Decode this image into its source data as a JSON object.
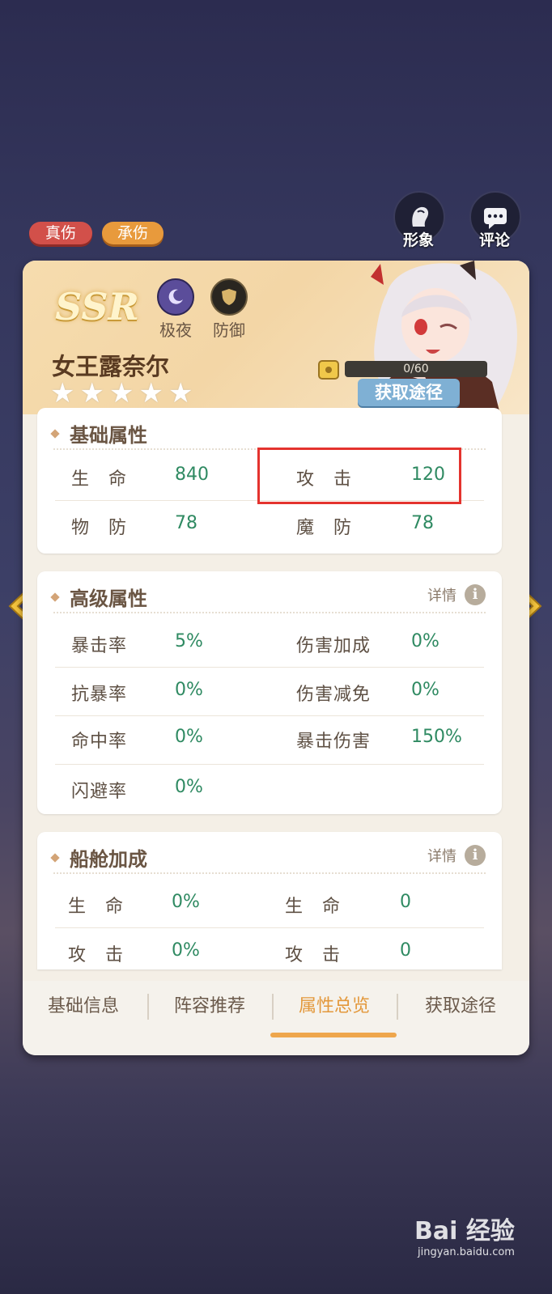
{
  "tags": {
    "true_damage": "真伤",
    "tank": "承伤"
  },
  "top_buttons": {
    "appearance": "形象",
    "comment": "评论"
  },
  "hero": {
    "rarity": "SSR",
    "traits": [
      {
        "label": "极夜",
        "icon": "moon-icon"
      },
      {
        "label": "防御",
        "icon": "shield-icon"
      }
    ],
    "name": "女王露奈尔",
    "stars_filled": 0,
    "stars_total": 5,
    "shards": "0/60",
    "get_button": "获取途径"
  },
  "basic_attrs": {
    "title": "基础属性",
    "rows": [
      {
        "l1": "生　命",
        "v1": "840",
        "l2": "攻　击",
        "v2": "120"
      },
      {
        "l1": "物　防",
        "v1": "78",
        "l2": "魔　防",
        "v2": "78"
      }
    ]
  },
  "advanced_attrs": {
    "title": "高级属性",
    "details": "详情",
    "rows": [
      {
        "l1": "暴击率",
        "v1": "5%",
        "l2": "伤害加成",
        "v2": "0%"
      },
      {
        "l1": "抗暴率",
        "v1": "0%",
        "l2": "伤害减免",
        "v2": "0%"
      },
      {
        "l1": "命中率",
        "v1": "0%",
        "l2": "暴击伤害",
        "v2": "150%"
      },
      {
        "l1": "闪避率",
        "v1": "0%"
      }
    ]
  },
  "cabin_bonus": {
    "title": "船舱加成",
    "details": "详情",
    "rows": [
      {
        "l1": "生　命",
        "v1": "0%",
        "l2": "生　命",
        "v2": "0"
      },
      {
        "l1": "攻　击",
        "v1": "0%",
        "l2": "攻　击",
        "v2": "0"
      }
    ]
  },
  "tabs": [
    "基础信息",
    "阵容推荐",
    "属性总览",
    "获取途径"
  ],
  "active_tab": "属性总览",
  "watermark": {
    "brand": "Bai 经验",
    "url": "jingyan.baidu.com"
  },
  "colors": {
    "value_green": "#2f8a62",
    "active_tab": "#e3983b",
    "highlight_red": "#e4332e"
  }
}
